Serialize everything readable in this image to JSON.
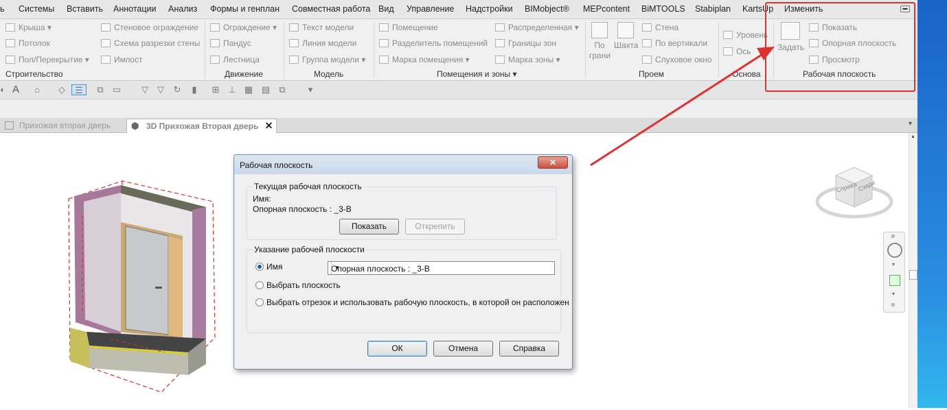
{
  "menu": [
    "ь",
    "Системы",
    "Вставить",
    "Аннотации",
    "Анализ",
    "Формы и генплан",
    "Совместная работа",
    "Вид",
    "Управление",
    "Надстройки",
    "BIMobject®",
    "MEPcontent",
    "BiMTOOLS",
    "Stabiplan",
    "KartsUp",
    "Изменить"
  ],
  "ribbon": {
    "build": {
      "items": [
        "Крыша",
        "Потолок",
        "Пол/Перекрытие",
        "Стеновое ограждение",
        "Схема разрезки стены",
        "Импост"
      ],
      "title": "Строительство"
    },
    "move": {
      "items": [
        "Ограждение",
        "Пандус",
        "Лестница"
      ],
      "title": "Движение"
    },
    "model": {
      "items": [
        "Текст модели",
        "Линия  модели",
        "Группа модели"
      ],
      "title": "Модель"
    },
    "rooms": {
      "items": [
        "Помещение",
        "Разделитель помещений",
        "Марка помещения",
        "Распределенная",
        "Границы  зон",
        "Марка  зоны"
      ],
      "title": "Помещения и зоны"
    },
    "opening": {
      "items": [
        "По грани",
        "Шахта",
        "Стена",
        "По вертикали",
        "Слуховое окно"
      ],
      "title": "Проем"
    },
    "base": {
      "items": [
        "Уровень",
        "Ось"
      ],
      "title": "Основа"
    },
    "workplane": {
      "items": [
        "Задать",
        "Показать",
        "Опорная плоскость",
        "Просмотр"
      ],
      "title": "Рабочая плоскость"
    }
  },
  "tabs": [
    "Прихожая вторая дверь",
    "3D Прихожая Вторая дверь"
  ],
  "viewcube": {
    "left": "Справа",
    "right": "Сзади"
  },
  "dialog": {
    "title": "Рабочая плоскость",
    "current": {
      "legend": "Текущая рабочая плоскость",
      "name_label": "Имя:",
      "ref_text": "Опорная плоскость : _3-В",
      "show_button": "Показать",
      "detach_button": "Открепить"
    },
    "specify": {
      "legend": "Указание рабочей плоскости",
      "opt_name": "Имя",
      "combo_value": "Опорная плоскость : _3-В",
      "opt_pick": "Выбрать плоскость",
      "opt_line": "Выбрать отрезок и использовать рабочую плоскость, в которой он расположен"
    },
    "buttons": {
      "ok": "ОК",
      "cancel": "Отмена",
      "help": "Справка"
    }
  },
  "colors": {
    "accent": "#e03030",
    "blue": "#1a63c7"
  }
}
